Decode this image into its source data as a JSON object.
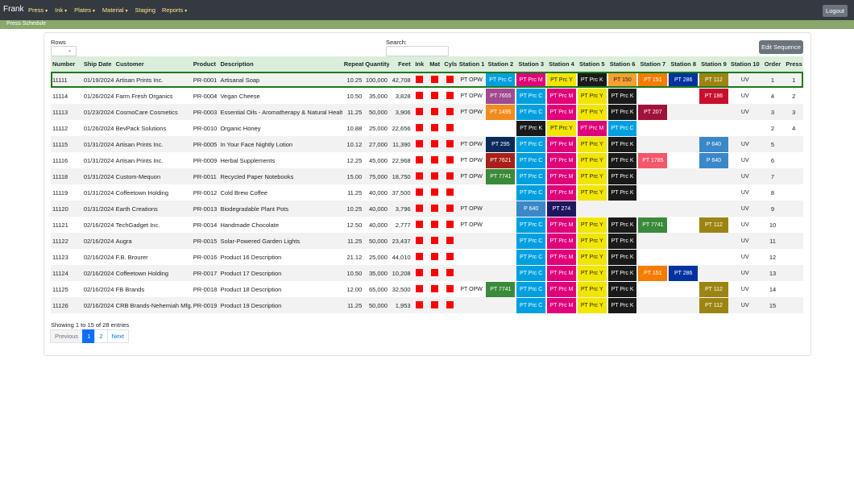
{
  "navbar": {
    "brand": "Frank",
    "items": [
      "Press",
      "Ink",
      "Plates",
      "Material",
      "Staging",
      "Reports"
    ],
    "logout": "Logout"
  },
  "subbar": {
    "title": "Press Schedule"
  },
  "controls": {
    "rows_label": "Rows",
    "search_label": "Search:",
    "edit_sequence": "Edit Sequence"
  },
  "table": {
    "headers": [
      "Number",
      "Ship Date",
      "Customer",
      "Product",
      "Description",
      "Repeat",
      "Quantity",
      "Feet",
      "Ink",
      "Mat",
      "Cyls",
      "Station 1",
      "Station 2",
      "Station 3",
      "Station 4",
      "Station 5",
      "Station 6",
      "Station 7",
      "Station 8",
      "Station 9",
      "Station 10",
      "Order",
      "Press"
    ],
    "rows": [
      {
        "number": "11111",
        "ship_date": "01/19/2024",
        "customer": "Artisan Prints Inc.",
        "product": "PR-0001",
        "description": "Artisanal Soap",
        "repeat": "10.25",
        "quantity": "100,000",
        "feet": "42,708",
        "order": "1",
        "press": "1",
        "selected": true,
        "stations": [
          {
            "label": "PT OPW",
            "color": ""
          },
          {
            "label": "PT Prc C",
            "color": "#00a0e0"
          },
          {
            "label": "PT Prc M",
            "color": "#e0007a"
          },
          {
            "label": "PT Prc Y",
            "color": "#f2e500"
          },
          {
            "label": "PT Prc K",
            "color": "#1a1a1a"
          },
          {
            "label": "PT 150",
            "color": "#f5a030"
          },
          {
            "label": "PT 151",
            "color": "#f57c00"
          },
          {
            "label": "PT 286",
            "color": "#0033a0"
          },
          {
            "label": "PT 112",
            "color": "#9c8412"
          },
          {
            "label": "UV",
            "color": ""
          }
        ]
      },
      {
        "number": "11114",
        "ship_date": "01/26/2024",
        "customer": "Farm Fresh Organics",
        "product": "PR-0004",
        "description": "Vegan Cheese",
        "repeat": "10.50",
        "quantity": "35,000",
        "feet": "3,828",
        "order": "4",
        "press": "2",
        "selected": false,
        "stations": [
          {
            "label": "PT OPW",
            "color": ""
          },
          {
            "label": "PT 7655",
            "color": "#a04a90"
          },
          {
            "label": "PT Prc C",
            "color": "#00a0e0"
          },
          {
            "label": "PT Prc M",
            "color": "#e0007a"
          },
          {
            "label": "PT Prc Y",
            "color": "#f2e500"
          },
          {
            "label": "PT Prc K",
            "color": "#1a1a1a"
          },
          {
            "label": "",
            "color": ""
          },
          {
            "label": "",
            "color": ""
          },
          {
            "label": "PT 186",
            "color": "#c8102e"
          },
          {
            "label": "UV",
            "color": ""
          }
        ]
      },
      {
        "number": "11113",
        "ship_date": "01/23/2024",
        "customer": "CosmoCare Cosmetics",
        "product": "PR-0003",
        "description": "Essential Oils - Aromatherapy & Natural Health",
        "repeat": "11.25",
        "quantity": "50,000",
        "feet": "3,906",
        "order": "3",
        "press": "3",
        "selected": false,
        "stations": [
          {
            "label": "PT OPW",
            "color": ""
          },
          {
            "label": "PT 1495",
            "color": "#f08c1e"
          },
          {
            "label": "PT Prc C",
            "color": "#00a0e0"
          },
          {
            "label": "PT Prc M",
            "color": "#e0007a"
          },
          {
            "label": "PT Prc Y",
            "color": "#f2e500"
          },
          {
            "label": "PT Prc K",
            "color": "#1a1a1a"
          },
          {
            "label": "PT 207",
            "color": "#a0123a"
          },
          {
            "label": "",
            "color": ""
          },
          {
            "label": "",
            "color": ""
          },
          {
            "label": "UV",
            "color": ""
          }
        ]
      },
      {
        "number": "11112",
        "ship_date": "01/26/2024",
        "customer": "BevPack Solutions",
        "product": "PR-0010",
        "description": "Organic Honey",
        "repeat": "10.88",
        "quantity": "25,000",
        "feet": "22,656",
        "order": "2",
        "press": "4",
        "selected": false,
        "stations": [
          {
            "label": "",
            "color": ""
          },
          {
            "label": "",
            "color": ""
          },
          {
            "label": "PT Prc K",
            "color": "#1a1a1a"
          },
          {
            "label": "PT Prc Y",
            "color": "#f2e500"
          },
          {
            "label": "PT Prc M",
            "color": "#e0007a"
          },
          {
            "label": "PT Prc C",
            "color": "#00a0e0"
          },
          {
            "label": "",
            "color": ""
          },
          {
            "label": "",
            "color": ""
          },
          {
            "label": "",
            "color": ""
          },
          {
            "label": "",
            "color": ""
          }
        ]
      },
      {
        "number": "11115",
        "ship_date": "01/31/2024",
        "customer": "Artisan Prints Inc.",
        "product": "PR-0005",
        "description": "In Your Face Nightly Lotion",
        "repeat": "10.12",
        "quantity": "27,000",
        "feet": "11,390",
        "order": "5",
        "press": "",
        "selected": false,
        "stations": [
          {
            "label": "PT OPW",
            "color": ""
          },
          {
            "label": "PT 295",
            "color": "#0b2a5a"
          },
          {
            "label": "PT Prc C",
            "color": "#00a0e0"
          },
          {
            "label": "PT Prc M",
            "color": "#e0007a"
          },
          {
            "label": "PT Prc Y",
            "color": "#f2e500"
          },
          {
            "label": "PT Prc K",
            "color": "#1a1a1a"
          },
          {
            "label": "",
            "color": ""
          },
          {
            "label": "",
            "color": ""
          },
          {
            "label": "P 640",
            "color": "#3a88c8"
          },
          {
            "label": "UV",
            "color": ""
          }
        ]
      },
      {
        "number": "11116",
        "ship_date": "01/31/2024",
        "customer": "Artisan Prints Inc.",
        "product": "PR-0009",
        "description": "Herbal Supplements",
        "repeat": "12.25",
        "quantity": "45,000",
        "feet": "22,968",
        "order": "6",
        "press": "",
        "selected": false,
        "stations": [
          {
            "label": "PT OPW",
            "color": ""
          },
          {
            "label": "PT 7621",
            "color": "#a8201a"
          },
          {
            "label": "PT Prc C",
            "color": "#00a0e0"
          },
          {
            "label": "PT Prc M",
            "color": "#e0007a"
          },
          {
            "label": "PT Prc Y",
            "color": "#f2e500"
          },
          {
            "label": "PT Prc K",
            "color": "#1a1a1a"
          },
          {
            "label": "PT 1785",
            "color": "#f4566a"
          },
          {
            "label": "",
            "color": ""
          },
          {
            "label": "P 640",
            "color": "#3a88c8"
          },
          {
            "label": "UV",
            "color": ""
          }
        ]
      },
      {
        "number": "11118",
        "ship_date": "01/31/2024",
        "customer": "Custom-Mequon",
        "product": "PR-0011",
        "description": "Recycled Paper Notebooks",
        "repeat": "15.00",
        "quantity": "75,000",
        "feet": "18,750",
        "order": "7",
        "press": "",
        "selected": false,
        "stations": [
          {
            "label": "PT OPW",
            "color": ""
          },
          {
            "label": "PT 7741",
            "color": "#3a8a3a"
          },
          {
            "label": "PT Prc C",
            "color": "#00a0e0"
          },
          {
            "label": "PT Prc M",
            "color": "#e0007a"
          },
          {
            "label": "PT Prc Y",
            "color": "#f2e500"
          },
          {
            "label": "PT Prc K",
            "color": "#1a1a1a"
          },
          {
            "label": "",
            "color": ""
          },
          {
            "label": "",
            "color": ""
          },
          {
            "label": "",
            "color": ""
          },
          {
            "label": "UV",
            "color": ""
          }
        ]
      },
      {
        "number": "11119",
        "ship_date": "01/31/2024",
        "customer": "Coffeetown Holding",
        "product": "PR-0012",
        "description": "Cold Brew Coffee",
        "repeat": "11.25",
        "quantity": "40,000",
        "feet": "37,500",
        "order": "8",
        "press": "",
        "selected": false,
        "stations": [
          {
            "label": "",
            "color": ""
          },
          {
            "label": "",
            "color": ""
          },
          {
            "label": "PT Prc C",
            "color": "#00a0e0"
          },
          {
            "label": "PT Prc M",
            "color": "#e0007a"
          },
          {
            "label": "PT Prc Y",
            "color": "#f2e500"
          },
          {
            "label": "PT Prc K",
            "color": "#1a1a1a"
          },
          {
            "label": "",
            "color": ""
          },
          {
            "label": "",
            "color": ""
          },
          {
            "label": "",
            "color": ""
          },
          {
            "label": "UV",
            "color": ""
          }
        ]
      },
      {
        "number": "11120",
        "ship_date": "01/31/2024",
        "customer": "Earth Creations",
        "product": "PR-0013",
        "description": "Biodegradable Plant Pots",
        "repeat": "10.25",
        "quantity": "40,000",
        "feet": "3,796",
        "order": "9",
        "press": "",
        "selected": false,
        "stations": [
          {
            "label": "PT OPW",
            "color": ""
          },
          {
            "label": "",
            "color": ""
          },
          {
            "label": "P 640",
            "color": "#3a88c8"
          },
          {
            "label": "PT 274",
            "color": "#1f1660"
          },
          {
            "label": "",
            "color": ""
          },
          {
            "label": "",
            "color": ""
          },
          {
            "label": "",
            "color": ""
          },
          {
            "label": "",
            "color": ""
          },
          {
            "label": "",
            "color": ""
          },
          {
            "label": "UV",
            "color": ""
          }
        ]
      },
      {
        "number": "11121",
        "ship_date": "02/16/2024",
        "customer": "TechGadget Inc.",
        "product": "PR-0014",
        "description": "Handmade Chocolate",
        "repeat": "12.50",
        "quantity": "40,000",
        "feet": "2,777",
        "order": "10",
        "press": "",
        "selected": false,
        "stations": [
          {
            "label": "PT OPW",
            "color": ""
          },
          {
            "label": "",
            "color": ""
          },
          {
            "label": "PT Prc C",
            "color": "#00a0e0"
          },
          {
            "label": "PT Prc M",
            "color": "#e0007a"
          },
          {
            "label": "PT Prc Y",
            "color": "#f2e500"
          },
          {
            "label": "PT Prc K",
            "color": "#1a1a1a"
          },
          {
            "label": "PT 7741",
            "color": "#3a8a3a"
          },
          {
            "label": "",
            "color": ""
          },
          {
            "label": "PT 112",
            "color": "#9c8412"
          },
          {
            "label": "UV",
            "color": ""
          }
        ]
      },
      {
        "number": "11122",
        "ship_date": "02/16/2024",
        "customer": "Augra",
        "product": "PR-0015",
        "description": "Solar-Powered Garden Lights",
        "repeat": "11.25",
        "quantity": "50,000",
        "feet": "23,437",
        "order": "11",
        "press": "",
        "selected": false,
        "stations": [
          {
            "label": "",
            "color": ""
          },
          {
            "label": "",
            "color": ""
          },
          {
            "label": "PT Prc C",
            "color": "#00a0e0"
          },
          {
            "label": "PT Prc M",
            "color": "#e0007a"
          },
          {
            "label": "PT Prc Y",
            "color": "#f2e500"
          },
          {
            "label": "PT Prc K",
            "color": "#1a1a1a"
          },
          {
            "label": "",
            "color": ""
          },
          {
            "label": "",
            "color": ""
          },
          {
            "label": "",
            "color": ""
          },
          {
            "label": "UV",
            "color": ""
          }
        ]
      },
      {
        "number": "11123",
        "ship_date": "02/16/2024",
        "customer": "F.B. Brourer",
        "product": "PR-0016",
        "description": "Product 16 Description",
        "repeat": "21.12",
        "quantity": "25,000",
        "feet": "44,010",
        "order": "12",
        "press": "",
        "selected": false,
        "stations": [
          {
            "label": "",
            "color": ""
          },
          {
            "label": "",
            "color": ""
          },
          {
            "label": "PT Prc C",
            "color": "#00a0e0"
          },
          {
            "label": "PT Prc M",
            "color": "#e0007a"
          },
          {
            "label": "PT Prc Y",
            "color": "#f2e500"
          },
          {
            "label": "PT Prc K",
            "color": "#1a1a1a"
          },
          {
            "label": "",
            "color": ""
          },
          {
            "label": "",
            "color": ""
          },
          {
            "label": "",
            "color": ""
          },
          {
            "label": "UV",
            "color": ""
          }
        ]
      },
      {
        "number": "11124",
        "ship_date": "02/16/2024",
        "customer": "Coffeetown Holding",
        "product": "PR-0017",
        "description": "Product 17 Description",
        "repeat": "10.50",
        "quantity": "35,000",
        "feet": "10,208",
        "order": "13",
        "press": "",
        "selected": false,
        "stations": [
          {
            "label": "",
            "color": ""
          },
          {
            "label": "",
            "color": ""
          },
          {
            "label": "PT Prc C",
            "color": "#00a0e0"
          },
          {
            "label": "PT Prc M",
            "color": "#e0007a"
          },
          {
            "label": "PT Prc Y",
            "color": "#f2e500"
          },
          {
            "label": "PT Prc K",
            "color": "#1a1a1a"
          },
          {
            "label": "PT 151",
            "color": "#f57c00"
          },
          {
            "label": "PT 286",
            "color": "#0033a0"
          },
          {
            "label": "",
            "color": ""
          },
          {
            "label": "UV",
            "color": ""
          }
        ]
      },
      {
        "number": "11125",
        "ship_date": "02/16/2024",
        "customer": "FB Brands",
        "product": "PR-0018",
        "description": "Product 18 Description",
        "repeat": "12.00",
        "quantity": "65,000",
        "feet": "32,500",
        "order": "14",
        "press": "",
        "selected": false,
        "stations": [
          {
            "label": "PT OPW",
            "color": ""
          },
          {
            "label": "PT 7741",
            "color": "#3a8a3a"
          },
          {
            "label": "PT Prc C",
            "color": "#00a0e0"
          },
          {
            "label": "PT Prc M",
            "color": "#e0007a"
          },
          {
            "label": "PT Prc Y",
            "color": "#f2e500"
          },
          {
            "label": "PT Prc K",
            "color": "#1a1a1a"
          },
          {
            "label": "",
            "color": ""
          },
          {
            "label": "",
            "color": ""
          },
          {
            "label": "PT 112",
            "color": "#9c8412"
          },
          {
            "label": "UV",
            "color": ""
          }
        ]
      },
      {
        "number": "11126",
        "ship_date": "02/16/2024",
        "customer": "CRB Brands-Nehemiah Mfg.",
        "product": "PR-0019",
        "description": "Product 19 Description",
        "repeat": "11.25",
        "quantity": "50,000",
        "feet": "1,953",
        "order": "15",
        "press": "",
        "selected": false,
        "stations": [
          {
            "label": "",
            "color": ""
          },
          {
            "label": "",
            "color": ""
          },
          {
            "label": "PT Prc C",
            "color": "#00a0e0"
          },
          {
            "label": "PT Prc M",
            "color": "#e0007a"
          },
          {
            "label": "PT Prc Y",
            "color": "#f2e500"
          },
          {
            "label": "PT Prc K",
            "color": "#1a1a1a"
          },
          {
            "label": "",
            "color": ""
          },
          {
            "label": "",
            "color": ""
          },
          {
            "label": "PT 112",
            "color": "#9c8412"
          },
          {
            "label": "UV",
            "color": ""
          }
        ]
      }
    ]
  },
  "footer": {
    "showing": "Showing 1 to 15 of 28 entries",
    "pagination": [
      "Previous",
      "1",
      "2",
      "Next"
    ]
  }
}
